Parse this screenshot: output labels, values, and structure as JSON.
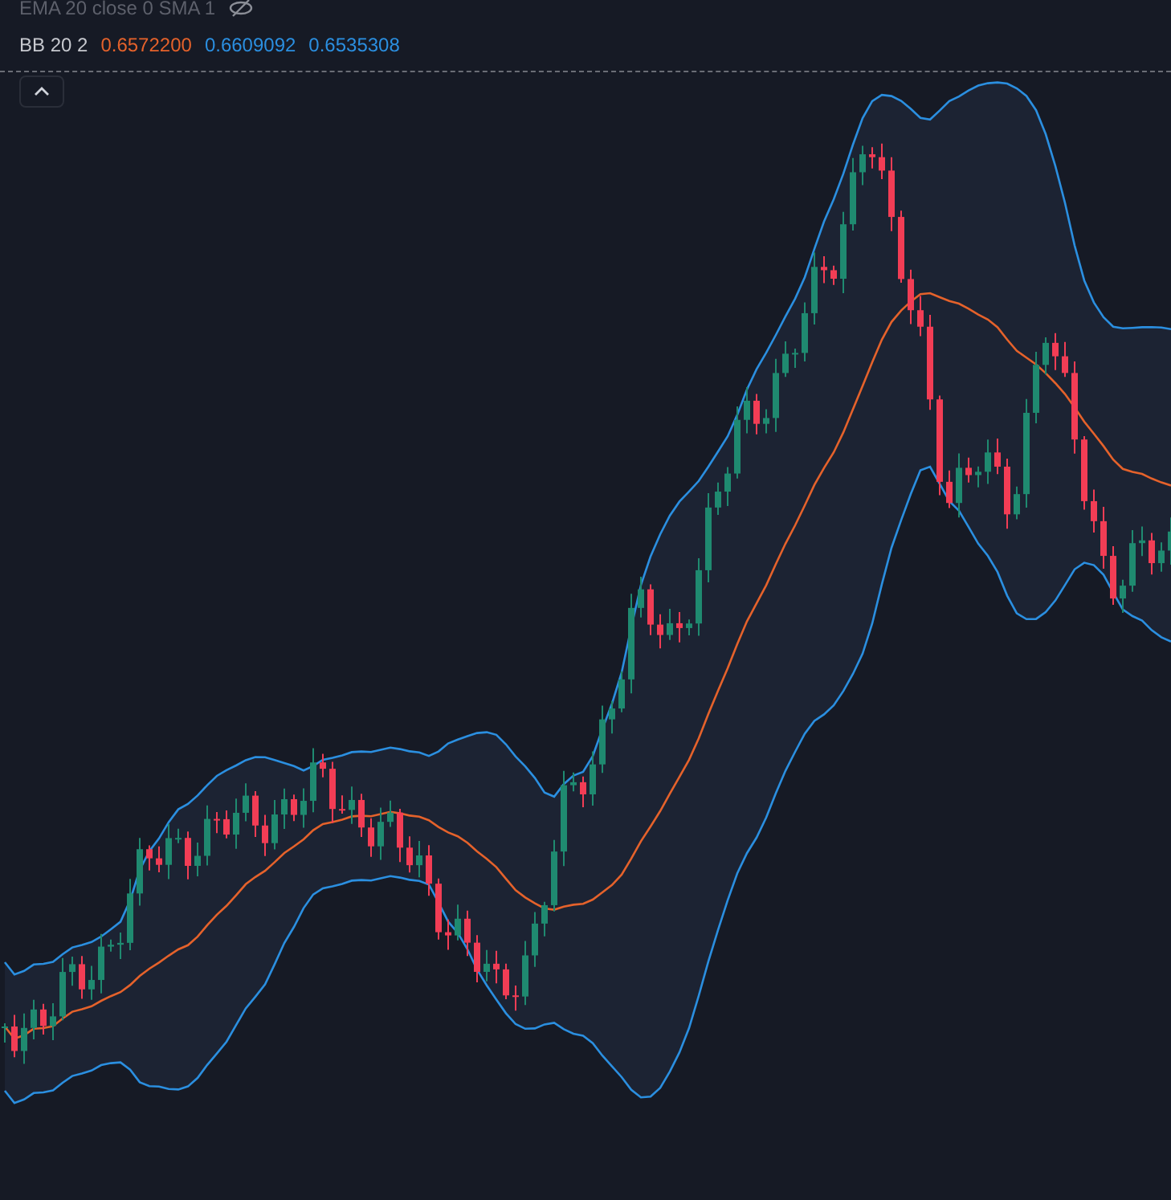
{
  "legend": {
    "ema": {
      "label": "EMA 20 close 0 SMA 1"
    },
    "bb": {
      "label": "BB 20 2",
      "values": [
        {
          "text": "0.6572200",
          "color": "#e5622b"
        },
        {
          "text": "0.6609092",
          "color": "#2b8fe0"
        },
        {
          "text": "0.6535308",
          "color": "#2b8fe0"
        }
      ]
    }
  }
}
